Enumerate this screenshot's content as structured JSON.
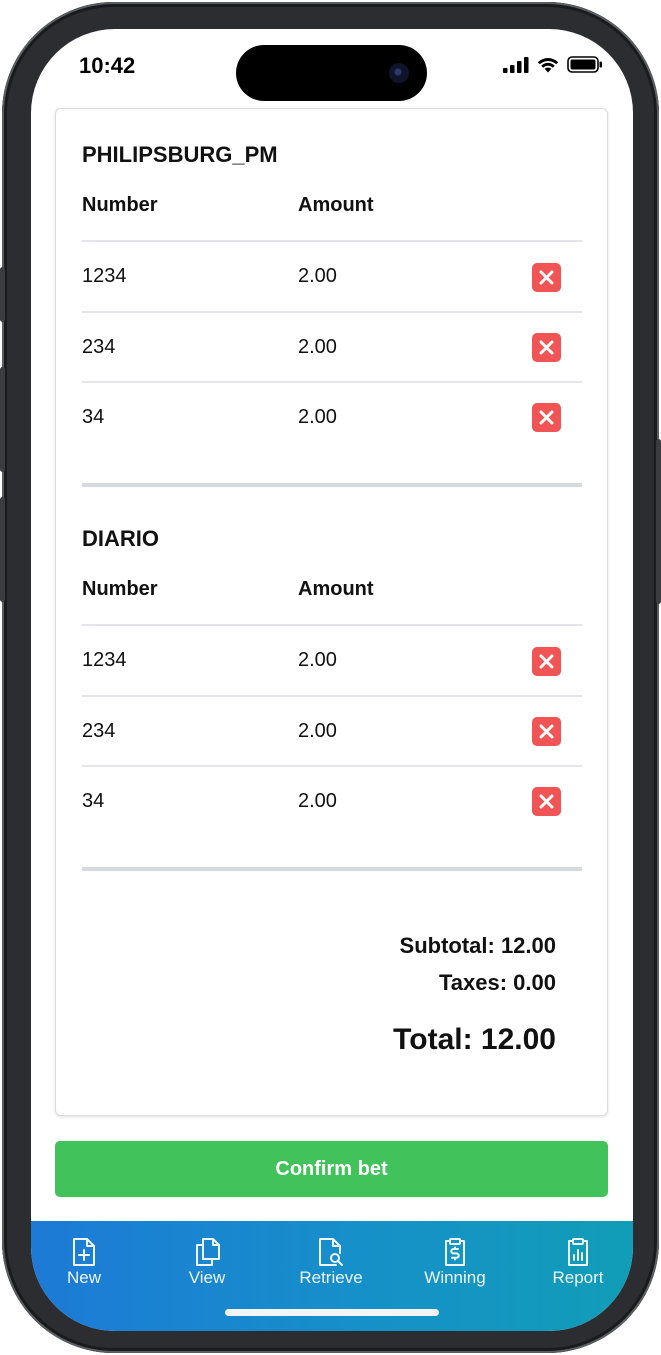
{
  "status_bar": {
    "time": "10:42"
  },
  "sections": [
    {
      "title": "PHILIPSBURG_PM",
      "headers": {
        "number": "Number",
        "amount": "Amount"
      },
      "rows": [
        {
          "number": "1234",
          "amount": "2.00"
        },
        {
          "number": "234",
          "amount": "2.00"
        },
        {
          "number": "34",
          "amount": "2.00"
        }
      ]
    },
    {
      "title": "DIARIO",
      "headers": {
        "number": "Number",
        "amount": "Amount"
      },
      "rows": [
        {
          "number": "1234",
          "amount": "2.00"
        },
        {
          "number": "234",
          "amount": "2.00"
        },
        {
          "number": "34",
          "amount": "2.00"
        }
      ]
    }
  ],
  "totals": {
    "subtotal": "Subtotal: 12.00",
    "taxes": "Taxes: 0.00",
    "total": "Total: 12.00"
  },
  "confirm_label": "Confirm bet",
  "nav": [
    {
      "label": "New",
      "icon": "file-plus-icon"
    },
    {
      "label": "View",
      "icon": "files-copy-icon"
    },
    {
      "label": "Retrieve",
      "icon": "file-search-icon"
    },
    {
      "label": "Winning",
      "icon": "dollar-doc-icon"
    },
    {
      "label": "Report",
      "icon": "clipboard-chart-icon"
    }
  ],
  "colors": {
    "confirm": "#41c25a",
    "delete": "#f05454",
    "nav_start": "#1d7ad6",
    "nav_end": "#119db7"
  }
}
